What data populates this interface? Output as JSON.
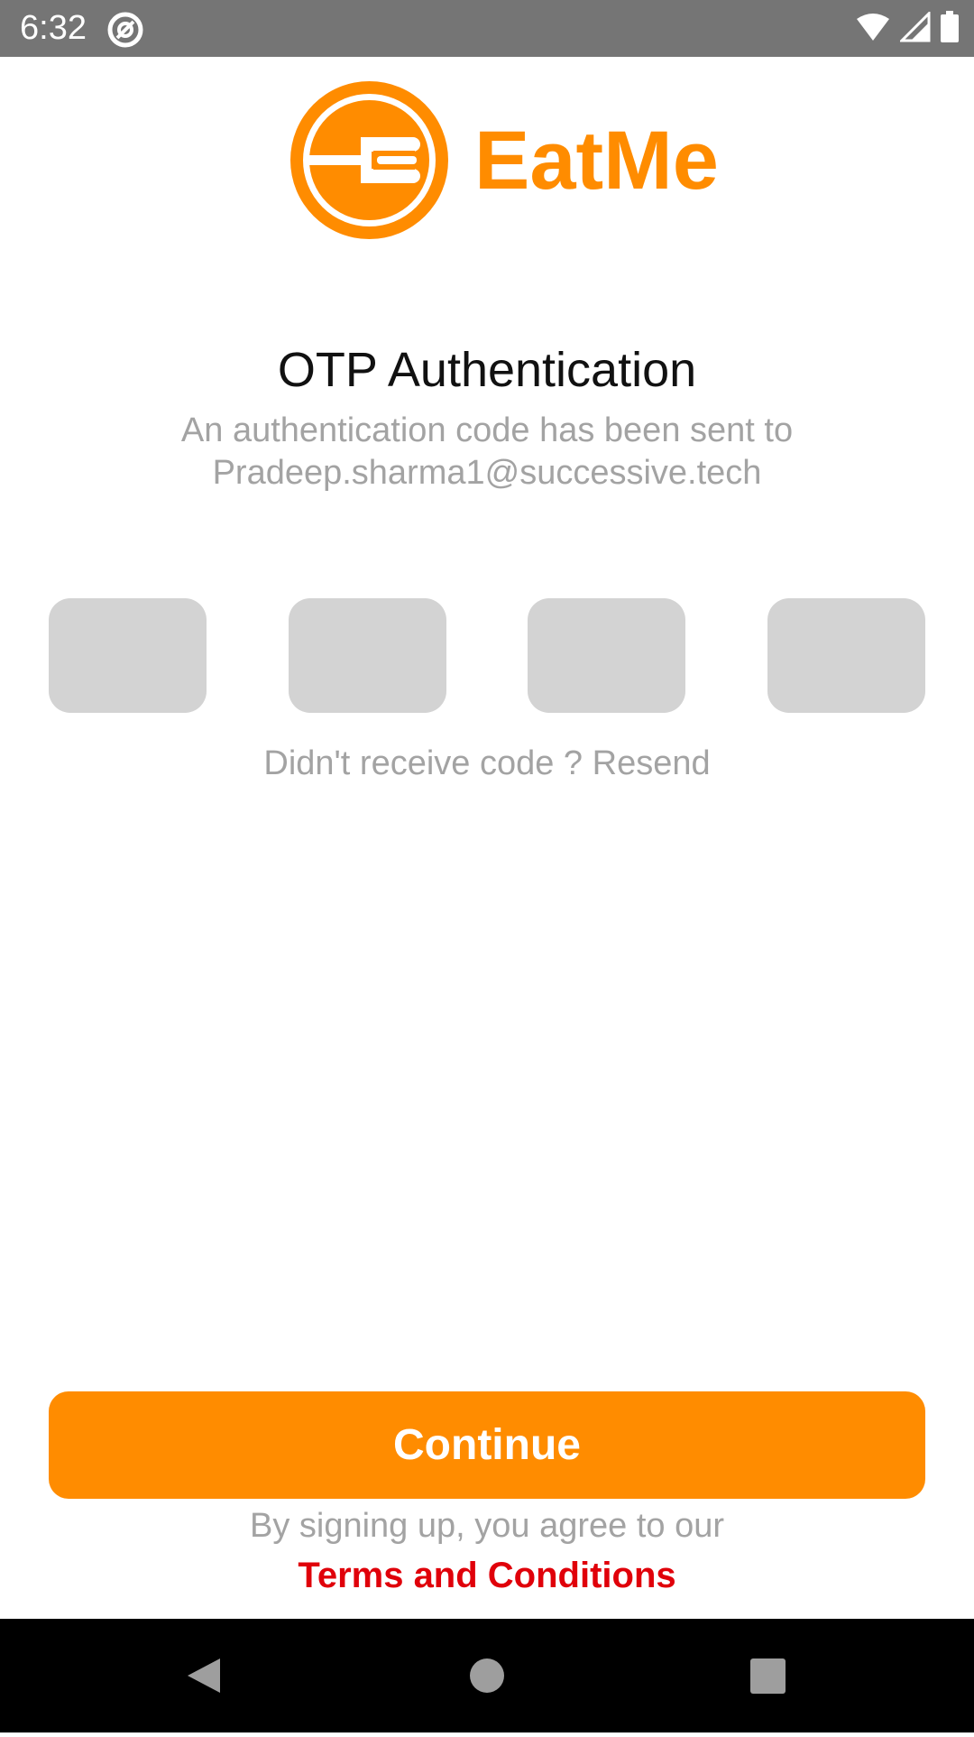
{
  "status_bar": {
    "time": "6:32",
    "icons": [
      "at-sign-icon",
      "wifi-icon",
      "signal-icon",
      "battery-icon"
    ],
    "background_color": "#757575"
  },
  "brand": {
    "name": "EatMe",
    "logo_icon": "fork-in-circle-icon",
    "color": "#ff8c00"
  },
  "otp": {
    "title": "OTP Authentication",
    "subtitle_line1": "An authentication code has been sent to",
    "subtitle_line2": "Pradeep.sharma1@successive.tech",
    "digits": [
      "",
      "",
      "",
      ""
    ],
    "resend_prefix": "Didn't receive code ?",
    "resend_label": "Resend"
  },
  "footer": {
    "continue_label": "Continue",
    "terms_prefix": "By signing up, you agree to our",
    "terms_link": "Terms and Conditions",
    "accent_color": "#ff8c00",
    "link_color": "#e0000a"
  },
  "nav_bar": {
    "buttons": [
      "back-icon",
      "home-icon",
      "recents-icon"
    ]
  }
}
